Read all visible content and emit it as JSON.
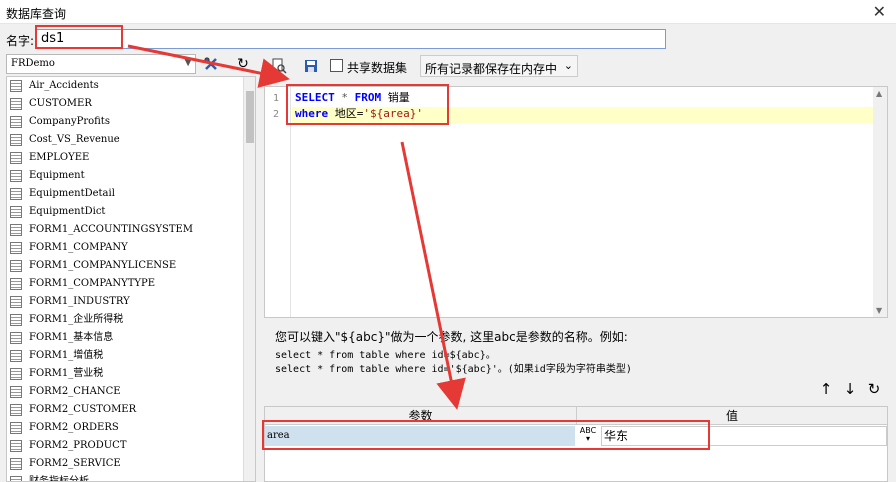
{
  "window": {
    "title": "数据库查询",
    "close_glyph": "✕"
  },
  "name_field": {
    "label": "名字:",
    "value": "ds1"
  },
  "left_panel": {
    "connection": "FRDemo",
    "tables": [
      "Air_Accidents",
      "CUSTOMER",
      "CompanyProfits",
      "Cost_VS_Revenue",
      "EMPLOYEE",
      "Equipment",
      "EquipmentDetail",
      "EquipmentDict",
      "FORM1_ACCOUNTINGSYSTEM",
      "FORM1_COMPANY",
      "FORM1_COMPANYLICENSE",
      "FORM1_COMPANYTYPE",
      "FORM1_INDUSTRY",
      "FORM1_企业所得税",
      "FORM1_基本信息",
      "FORM1_增值税",
      "FORM1_营业税",
      "FORM2_CHANCE",
      "FORM2_CUSTOMER",
      "FORM2_ORDERS",
      "FORM2_PRODUCT",
      "FORM2_SERVICE",
      "财务指标分析"
    ]
  },
  "toolbar": {
    "share_label": "共享数据集",
    "memory_option": "所有记录都保存在内存中"
  },
  "editor": {
    "line_numbers": [
      "1",
      "2"
    ],
    "line1": {
      "kw1": "SELECT",
      "star": " * ",
      "kw2": "FROM",
      "table": " 销量"
    },
    "line2": {
      "kw": "where",
      "field": " 地区=",
      "string": "'${area}'"
    }
  },
  "hint": {
    "line1": "您可以键入\"${abc}\"做为一个参数, 这里abc是参数的名称。例如:",
    "line2": "select * from table where id=${abc}。",
    "line3": "select * from table where id='${abc}'。(如果id字段为字符串类型)"
  },
  "params": {
    "header_param": "参数",
    "header_value": "值",
    "rows": [
      {
        "name": "area",
        "type_icon": "ABC",
        "value": "华东"
      }
    ]
  },
  "colors": {
    "annotation": "#e53935",
    "keyword": "#0000ff",
    "param_row_bg": "#cfe0ee"
  }
}
